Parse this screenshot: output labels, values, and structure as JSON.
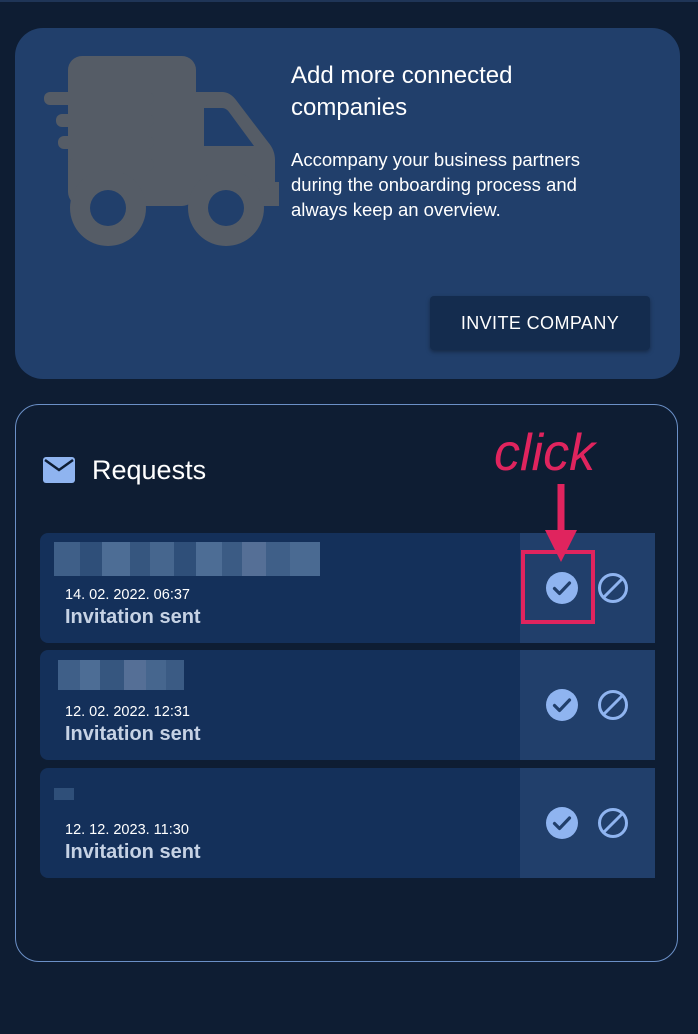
{
  "promo": {
    "title": "Add more connected companies",
    "text": "Accompany your business partners during the onboarding process and always keep an overview.",
    "invite_label": "INVITE COMPANY",
    "illustration": "truck-icon"
  },
  "requests": {
    "title": "Requests",
    "icon": "mail-icon",
    "annotation": "click",
    "items": [
      {
        "name": "",
        "date": "14. 02. 2022. 06:37",
        "status": "Invitation sent"
      },
      {
        "name": "",
        "date": "12. 02. 2022. 12:31",
        "status": "Invitation sent"
      },
      {
        "name": "",
        "date": "12. 12. 2023. 11:30",
        "status": "Invitation sent"
      }
    ]
  },
  "colors": {
    "background": "#0e1d33",
    "card": "#213f6b",
    "row": "#14305a",
    "accent_icon": "#8fb4f0",
    "annotation": "#e0245e"
  }
}
